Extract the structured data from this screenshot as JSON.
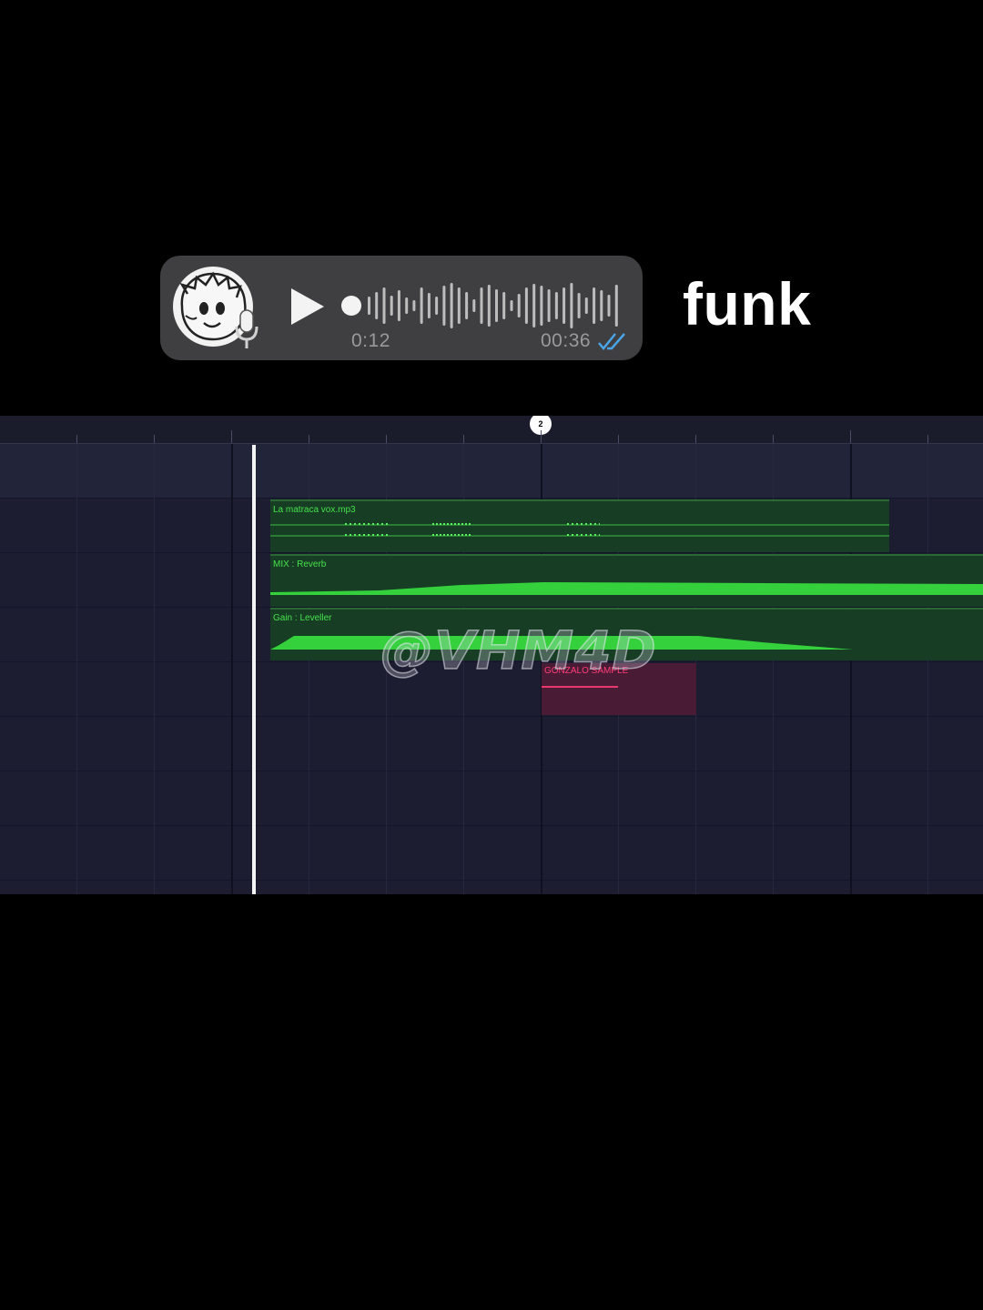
{
  "voice_message": {
    "elapsed": "0:12",
    "duration": "00:36",
    "playback_progress": 0.0
  },
  "caption": "funk",
  "timeline": {
    "marker": "2",
    "clips": [
      {
        "label": "La matraca vox.mp3"
      },
      {
        "label": "MIX : Reverb"
      },
      {
        "label": "Gain : Leveller"
      },
      {
        "label": "GONZALO SAMPLE"
      }
    ]
  },
  "watermark": "@VHM4D",
  "colors": {
    "clip_green": "#44e24a",
    "clip_bg": "#183d25",
    "sample_pink": "#ff3d7a",
    "timeline_bg": "#1c1d30"
  },
  "icons": {
    "play": "play-icon",
    "mic": "mic-icon",
    "read": "double-check-icon",
    "avatar": "cartoon-avatar"
  }
}
